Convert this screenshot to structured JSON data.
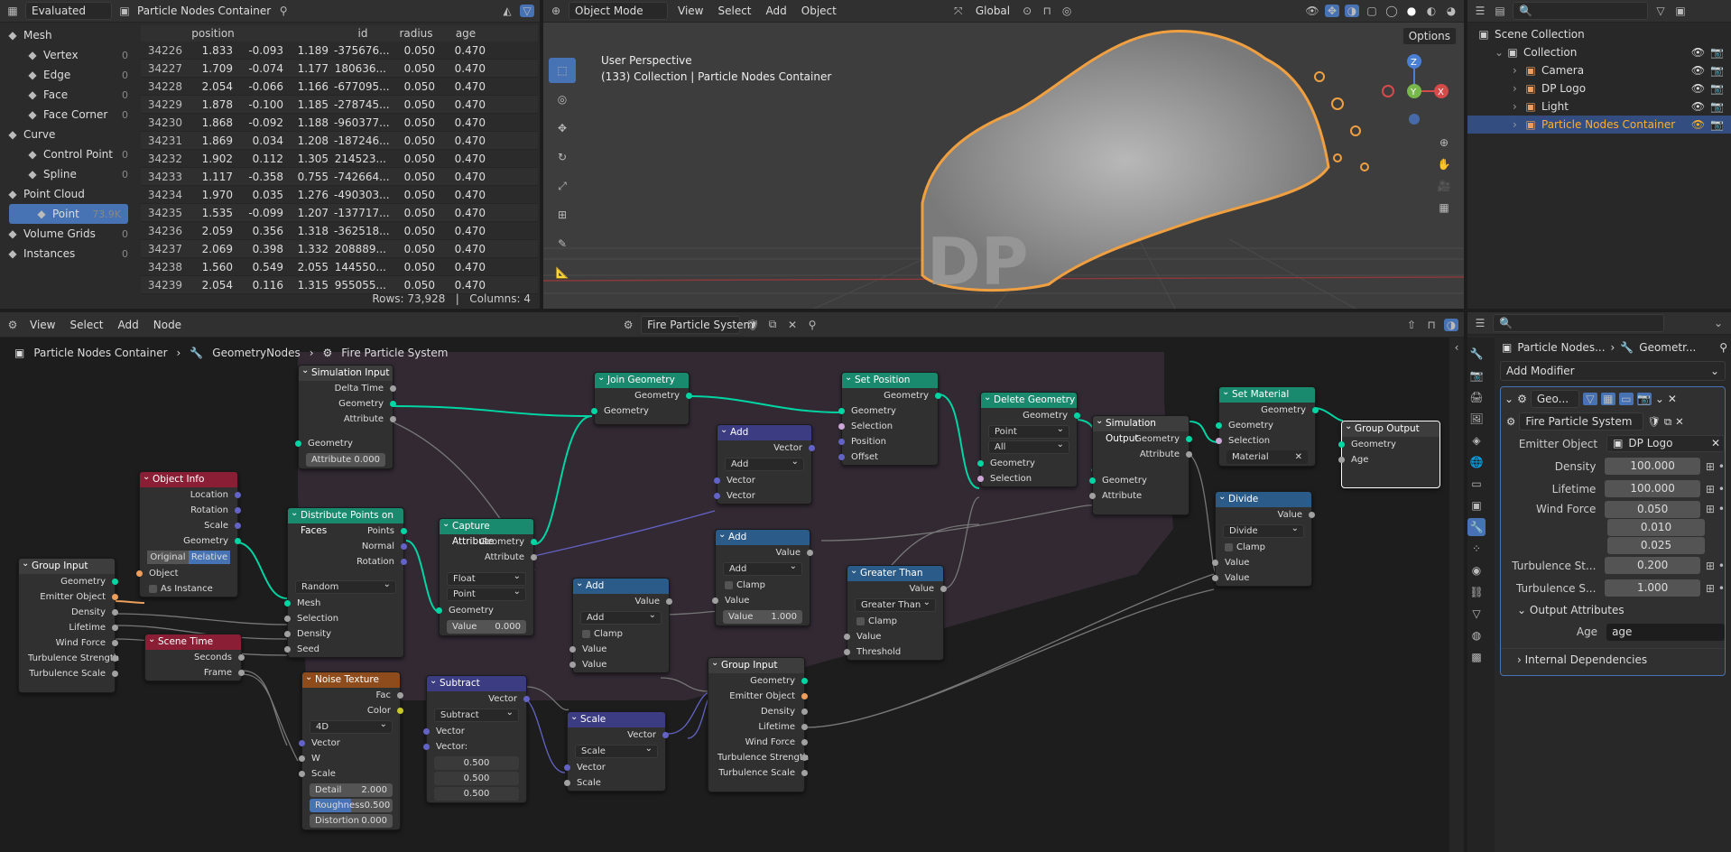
{
  "spreadsheet": {
    "header": {
      "evaluated": "Evaluated",
      "object": "Particle Nodes Container"
    },
    "domains": [
      {
        "label": "Mesh",
        "count": "",
        "indent": 0,
        "icon": "mesh-icon"
      },
      {
        "label": "Vertex",
        "count": "0",
        "indent": 1,
        "icon": "vertex-icon"
      },
      {
        "label": "Edge",
        "count": "0",
        "indent": 1,
        "icon": "edge-icon"
      },
      {
        "label": "Face",
        "count": "0",
        "indent": 1,
        "icon": "face-icon"
      },
      {
        "label": "Face Corner",
        "count": "0",
        "indent": 1,
        "icon": "face-corner-icon"
      },
      {
        "label": "Curve",
        "count": "",
        "indent": 0,
        "icon": "curve-icon"
      },
      {
        "label": "Control Point",
        "count": "0",
        "indent": 1,
        "icon": "control-point-icon"
      },
      {
        "label": "Spline",
        "count": "0",
        "indent": 1,
        "icon": "spline-icon"
      },
      {
        "label": "Point Cloud",
        "count": "",
        "indent": 0,
        "icon": "point-cloud-icon"
      },
      {
        "label": "Point",
        "count": "73.9K",
        "indent": 1,
        "icon": "point-icon",
        "active": true
      },
      {
        "label": "Volume Grids",
        "count": "0",
        "indent": 0,
        "icon": "volume-icon"
      },
      {
        "label": "Instances",
        "count": "0",
        "indent": 0,
        "icon": "instances-icon"
      }
    ],
    "columns": [
      "",
      "position",
      "",
      "",
      "id",
      "radius",
      "age"
    ],
    "rows": [
      [
        "34226",
        "1.833",
        "-0.093",
        "1.189",
        "-375676...",
        "0.050",
        "0.470"
      ],
      [
        "34227",
        "1.709",
        "-0.074",
        "1.177",
        "180636...",
        "0.050",
        "0.470"
      ],
      [
        "34228",
        "2.054",
        "-0.066",
        "1.166",
        "-677095...",
        "0.050",
        "0.470"
      ],
      [
        "34229",
        "1.878",
        "-0.100",
        "1.185",
        "-278745...",
        "0.050",
        "0.470"
      ],
      [
        "34230",
        "1.868",
        "-0.092",
        "1.188",
        "-960377...",
        "0.050",
        "0.470"
      ],
      [
        "34231",
        "1.869",
        "0.034",
        "1.208",
        "-187246...",
        "0.050",
        "0.470"
      ],
      [
        "34232",
        "1.902",
        "0.112",
        "1.305",
        "214523...",
        "0.050",
        "0.470"
      ],
      [
        "34233",
        "1.117",
        "-0.358",
        "0.755",
        "-742664...",
        "0.050",
        "0.470"
      ],
      [
        "34234",
        "1.970",
        "0.035",
        "1.276",
        "-490303...",
        "0.050",
        "0.470"
      ],
      [
        "34235",
        "1.535",
        "-0.099",
        "1.207",
        "-137717...",
        "0.050",
        "0.470"
      ],
      [
        "34236",
        "2.059",
        "0.356",
        "1.318",
        "-362518...",
        "0.050",
        "0.470"
      ],
      [
        "34237",
        "2.069",
        "0.398",
        "1.332",
        "208889...",
        "0.050",
        "0.470"
      ],
      [
        "34238",
        "1.560",
        "0.549",
        "2.055",
        "144550...",
        "0.050",
        "0.470"
      ],
      [
        "34239",
        "2.054",
        "0.116",
        "1.315",
        "955055...",
        "0.050",
        "0.470"
      ]
    ],
    "footer": "Rows: 73,928   |   Columns: 4"
  },
  "viewport": {
    "mode": "Object Mode",
    "menus": [
      "View",
      "Select",
      "Add",
      "Object"
    ],
    "orientation": "Global",
    "title": "User Perspective",
    "subtitle": "(133) Collection | Particle Nodes Container",
    "options": "Options",
    "gizmo": {
      "z": "Z",
      "y": "Y",
      "x": "X"
    }
  },
  "outliner": {
    "items": [
      {
        "label": "Scene Collection",
        "indent": 0,
        "icon": "scene-collection-icon"
      },
      {
        "label": "Collection",
        "indent": 1,
        "icon": "collection-icon"
      },
      {
        "label": "Camera",
        "indent": 2,
        "icon": "camera-icon"
      },
      {
        "label": "DP Logo",
        "indent": 2,
        "icon": "mesh-object-icon"
      },
      {
        "label": "Light",
        "indent": 2,
        "icon": "light-icon"
      },
      {
        "label": "Particle Nodes Container",
        "indent": 2,
        "icon": "pointcloud-object-icon",
        "active": true
      }
    ]
  },
  "node_editor": {
    "menus": [
      "View",
      "Select",
      "Add",
      "Node"
    ],
    "tree_name": "Fire Particle System",
    "breadcrumb": [
      "Particle Nodes Container",
      "GeometryNodes",
      "Fire Particle System"
    ]
  },
  "nodes": {
    "sim_input": {
      "title": "Simulation Input",
      "rows": [
        "Delta Time",
        "Geometry",
        "Attribute",
        "Geometry"
      ],
      "attr_label": "Attribute",
      "attr_val": "0.000"
    },
    "object_info": {
      "title": "Object Info",
      "rows": [
        "Location",
        "Rotation",
        "Scale",
        "Geometry"
      ],
      "seg": [
        "Original",
        "Relative"
      ],
      "object": "Object",
      "as_instance": "As Instance"
    },
    "group_input1": {
      "title": "Group Input",
      "rows": [
        "Geometry",
        "Emitter Object",
        "Density",
        "Lifetime",
        "Wind Force",
        "Turbulence Strength",
        "Turbulence Scale"
      ]
    },
    "scene_time": {
      "title": "Scene Time",
      "rows": [
        "Seconds",
        "Frame"
      ]
    },
    "distribute": {
      "title": "Distribute Points on Faces",
      "rows": [
        "Points",
        "Normal",
        "Rotation"
      ],
      "mode": "Random",
      "inputs": [
        "Mesh",
        "Selection",
        "Density",
        "Seed"
      ]
    },
    "capture": {
      "title": "Capture Attribute",
      "rows": [
        "Geometry",
        "Attribute"
      ],
      "type": "Float",
      "domain": "Point",
      "inputs": [
        "Geometry"
      ],
      "val_label": "Value",
      "val": "0.000"
    },
    "join": {
      "title": "Join Geometry",
      "out": "Geometry",
      "in": "Geometry"
    },
    "add1": {
      "title": "Add",
      "out": "Vector",
      "op": "Add",
      "inputs": [
        "Vector",
        "Vector"
      ]
    },
    "add2": {
      "title": "Add",
      "out": "Value",
      "op": "Add",
      "clamp": "Clamp",
      "inputs": [
        "Value"
      ],
      "val_label": "Value",
      "val": "1.000"
    },
    "add3": {
      "title": "Add",
      "out": "Value",
      "op": "Add",
      "clamp": "Clamp",
      "inputs": [
        "Value",
        "Value"
      ]
    },
    "noise": {
      "title": "Noise Texture",
      "rows": [
        "Fac",
        "Color"
      ],
      "dim": "4D",
      "inputs": [
        "Vector",
        "W",
        "Scale"
      ],
      "detail": "Detail",
      "detail_val": "2.000",
      "rough": "Roughness",
      "rough_val": "0.500",
      "dist": "Distortion",
      "dist_val": "0.000"
    },
    "subtract": {
      "title": "Subtract",
      "out": "Vector",
      "op": "Subtract",
      "inputs": [
        "Vector",
        "Vector:"
      ],
      "vals": [
        "0.500",
        "0.500",
        "0.500"
      ]
    },
    "scale": {
      "title": "Scale",
      "out": "Vector",
      "op": "Scale",
      "inputs": [
        "Vector",
        "Scale"
      ]
    },
    "group_input2": {
      "title": "Group Input",
      "rows": [
        "Geometry",
        "Emitter Object",
        "Density",
        "Lifetime",
        "Wind Force",
        "Turbulence Strength",
        "Turbulence Scale"
      ]
    },
    "set_position": {
      "title": "Set Position",
      "out": "Geometry",
      "inputs": [
        "Geometry",
        "Selection",
        "Position",
        "Offset"
      ]
    },
    "greater": {
      "title": "Greater Than",
      "out": "Value",
      "op": "Greater Than",
      "clamp": "Clamp",
      "inputs": [
        "Value",
        "Threshold"
      ]
    },
    "delete": {
      "title": "Delete Geometry",
      "out": "Geometry",
      "dom": "Point",
      "mode": "All",
      "inputs": [
        "Geometry",
        "Selection"
      ]
    },
    "sim_output": {
      "title": "Simulation Output",
      "rows": [
        "Geometry",
        "Attribute"
      ],
      "inputs": [
        "Geometry",
        "Attribute"
      ]
    },
    "set_material": {
      "title": "Set Material",
      "out": "Geometry",
      "inputs": [
        "Geometry",
        "Selection"
      ],
      "material": "Material"
    },
    "divide": {
      "title": "Divide",
      "out": "Value",
      "op": "Divide",
      "clamp": "Clamp",
      "inputs": [
        "Value",
        "Value"
      ]
    },
    "group_output": {
      "title": "Group Output",
      "inputs": [
        "Geometry",
        "Age"
      ]
    }
  },
  "properties": {
    "breadcrumb": [
      "Particle Nodes...",
      "Geometr..."
    ],
    "add_modifier": "Add Modifier",
    "modifier_name": "Geo...",
    "tree": "Fire Particle System",
    "fields": [
      {
        "label": "Emitter Object",
        "value": "DP Logo"
      },
      {
        "label": "Density",
        "value": "100.000"
      },
      {
        "label": "Lifetime",
        "value": "100.000"
      },
      {
        "label": "Wind Force",
        "value": "0.050"
      },
      {
        "label": "",
        "value": "0.010"
      },
      {
        "label": "",
        "value": "0.025"
      },
      {
        "label": "Turbulence St...",
        "value": "0.200"
      },
      {
        "label": "Turbulence S...",
        "value": "1.000"
      }
    ],
    "output_attributes": "Output Attributes",
    "age_label": "Age",
    "age_value": "age",
    "internal": "Internal Dependencies"
  }
}
